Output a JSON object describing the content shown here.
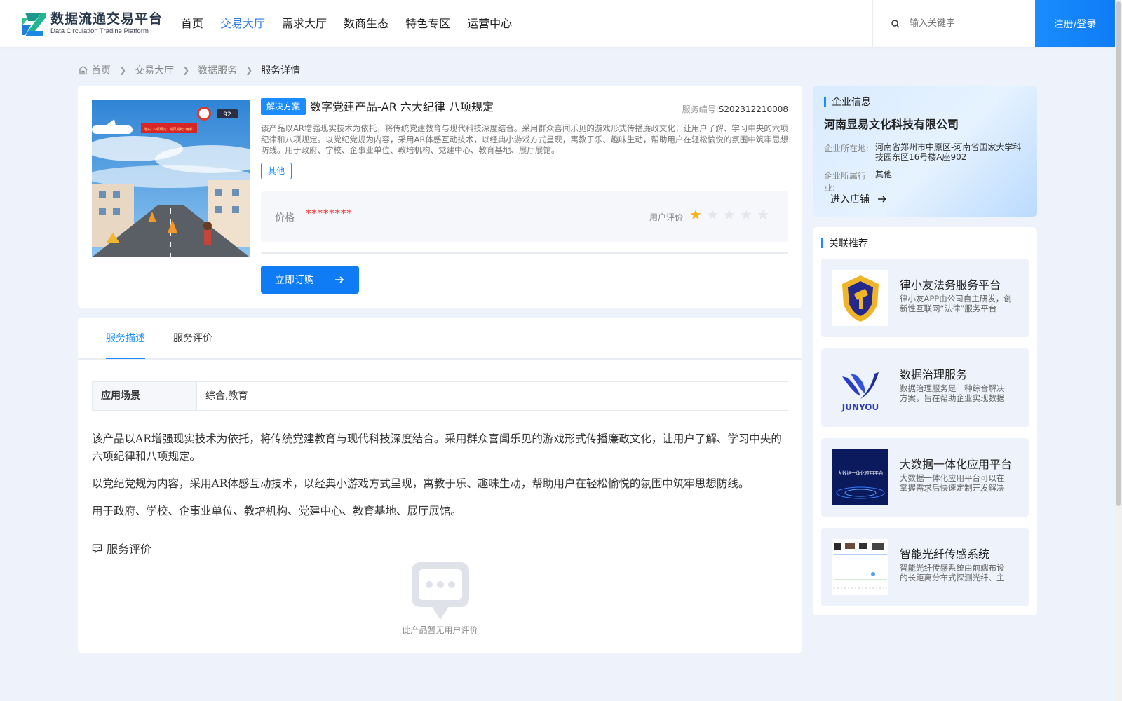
{
  "header": {
    "logo_cn": "数据流通交易平台",
    "logo_en": "Data Circulation Tradine Platform",
    "nav": [
      "首页",
      "交易大厅",
      "需求大厅",
      "数商生态",
      "特色专区",
      "运营中心"
    ],
    "active_nav": "交易大厅",
    "search_placeholder": "输入关键字",
    "login_label": "注册/登录"
  },
  "breadcrumb": {
    "home": "首页",
    "items": [
      "交易大厅",
      "数据服务"
    ],
    "current": "服务详情"
  },
  "product": {
    "tag": "解决方案",
    "title": "数字党建产品-AR 六大纪律 八项规定",
    "code_label": "服务编号:",
    "code": "S202312210008",
    "description": "该产品以AR增强现实技术为依托，将传统党建教育与现代科技深度结合。采用群众喜闻乐见的游戏形式传播廉政文化，让用户了解、学习中央的六项纪律和八项规定。以党纪党规为内容，采用AR体感互动技术，以经典小游戏方式呈现，寓教于乐、趣味生动，帮助用户在轻松愉悦的氛围中筑牢思想防线。用于政府、学校、企事业单位、教培机构、党建中心、教育基地、展厅展馆。",
    "chip": "其他",
    "price_label": "价格",
    "price": "********",
    "rating_label": "用户评价",
    "rating": 1,
    "rating_max": 5,
    "buy_label": "立即订购",
    "image": {
      "banner_text": "落实“八项规定”  党风党纪“两手”",
      "score": "92"
    }
  },
  "company": {
    "section_title": "企业信息",
    "name": "河南显易文化科技有限公司",
    "location_label": "企业所在地:",
    "location": "河南省郑州市中原区-河南省国家大学科技园东区16号楼A座902",
    "industry_label": "企业所属行业:",
    "industry": "其他",
    "enter_label": "进入店铺"
  },
  "recommend": {
    "section_title": "关联推荐",
    "items": [
      {
        "title": "律小友法务服务平台",
        "desc": "律小友APP由公司自主研发，创新性互联网“法律”服务平台"
      },
      {
        "title": "数据治理服务",
        "desc": "数据治理服务是一种综合解决方案，旨在帮助企业实现数据资产价值",
        "logo_text": "JUNYOU"
      },
      {
        "title": "大数据一体化应用平台",
        "desc": "大数据一体化应用平台可以在掌握需求后快速定制开发解决方案",
        "thumb_text": "大数据一体化应用平台"
      },
      {
        "title": "智能光纤传感系统",
        "desc": "智能光纤传感系统由前端布设的长距离分布式探测光纤、主机组成"
      }
    ]
  },
  "detail": {
    "tabs": [
      "服务描述",
      "服务评价"
    ],
    "active_tab": "服务描述",
    "scene_label": "应用场景",
    "scene_value": "综合,教育",
    "paragraphs": [
      "该产品以AR增强现实技术为依托，将传统党建教育与现代科技深度结合。采用群众喜闻乐见的游戏形式传播廉政文化，让用户了解、学习中央的六项纪律和八项规定。",
      "以党纪党规为内容，采用AR体感互动技术，以经典小游戏方式呈现，寓教于乐、趣味生动，帮助用户在轻松愉悦的氛围中筑牢思想防线。",
      "用于政府、学校、企事业单位、教培机构、党建中心、教育基地、展厅展馆。"
    ],
    "review_title": "服务评价",
    "empty_text": "此产品暂无用户评价"
  },
  "colors": {
    "accent": "#1a8cff",
    "price": "#f04b4b",
    "star": "#f7b11b",
    "page_bg": "#eef2fa"
  }
}
